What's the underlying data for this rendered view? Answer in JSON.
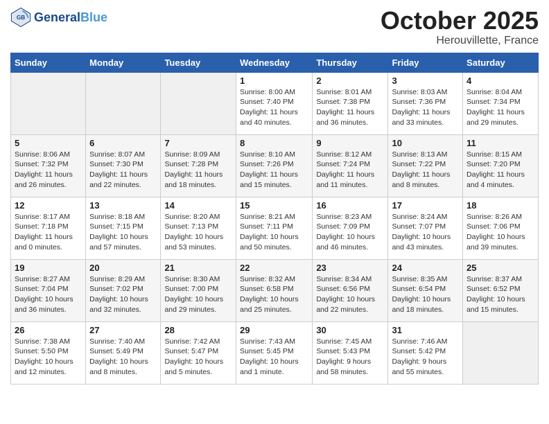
{
  "header": {
    "logo_line1": "General",
    "logo_line2": "Blue",
    "month": "October 2025",
    "location": "Herouvillette, France"
  },
  "weekdays": [
    "Sunday",
    "Monday",
    "Tuesday",
    "Wednesday",
    "Thursday",
    "Friday",
    "Saturday"
  ],
  "weeks": [
    [
      {
        "day": "",
        "info": ""
      },
      {
        "day": "",
        "info": ""
      },
      {
        "day": "",
        "info": ""
      },
      {
        "day": "1",
        "info": "Sunrise: 8:00 AM\nSunset: 7:40 PM\nDaylight: 11 hours\nand 40 minutes."
      },
      {
        "day": "2",
        "info": "Sunrise: 8:01 AM\nSunset: 7:38 PM\nDaylight: 11 hours\nand 36 minutes."
      },
      {
        "day": "3",
        "info": "Sunrise: 8:03 AM\nSunset: 7:36 PM\nDaylight: 11 hours\nand 33 minutes."
      },
      {
        "day": "4",
        "info": "Sunrise: 8:04 AM\nSunset: 7:34 PM\nDaylight: 11 hours\nand 29 minutes."
      }
    ],
    [
      {
        "day": "5",
        "info": "Sunrise: 8:06 AM\nSunset: 7:32 PM\nDaylight: 11 hours\nand 26 minutes."
      },
      {
        "day": "6",
        "info": "Sunrise: 8:07 AM\nSunset: 7:30 PM\nDaylight: 11 hours\nand 22 minutes."
      },
      {
        "day": "7",
        "info": "Sunrise: 8:09 AM\nSunset: 7:28 PM\nDaylight: 11 hours\nand 18 minutes."
      },
      {
        "day": "8",
        "info": "Sunrise: 8:10 AM\nSunset: 7:26 PM\nDaylight: 11 hours\nand 15 minutes."
      },
      {
        "day": "9",
        "info": "Sunrise: 8:12 AM\nSunset: 7:24 PM\nDaylight: 11 hours\nand 11 minutes."
      },
      {
        "day": "10",
        "info": "Sunrise: 8:13 AM\nSunset: 7:22 PM\nDaylight: 11 hours\nand 8 minutes."
      },
      {
        "day": "11",
        "info": "Sunrise: 8:15 AM\nSunset: 7:20 PM\nDaylight: 11 hours\nand 4 minutes."
      }
    ],
    [
      {
        "day": "12",
        "info": "Sunrise: 8:17 AM\nSunset: 7:18 PM\nDaylight: 11 hours\nand 0 minutes."
      },
      {
        "day": "13",
        "info": "Sunrise: 8:18 AM\nSunset: 7:15 PM\nDaylight: 10 hours\nand 57 minutes."
      },
      {
        "day": "14",
        "info": "Sunrise: 8:20 AM\nSunset: 7:13 PM\nDaylight: 10 hours\nand 53 minutes."
      },
      {
        "day": "15",
        "info": "Sunrise: 8:21 AM\nSunset: 7:11 PM\nDaylight: 10 hours\nand 50 minutes."
      },
      {
        "day": "16",
        "info": "Sunrise: 8:23 AM\nSunset: 7:09 PM\nDaylight: 10 hours\nand 46 minutes."
      },
      {
        "day": "17",
        "info": "Sunrise: 8:24 AM\nSunset: 7:07 PM\nDaylight: 10 hours\nand 43 minutes."
      },
      {
        "day": "18",
        "info": "Sunrise: 8:26 AM\nSunset: 7:06 PM\nDaylight: 10 hours\nand 39 minutes."
      }
    ],
    [
      {
        "day": "19",
        "info": "Sunrise: 8:27 AM\nSunset: 7:04 PM\nDaylight: 10 hours\nand 36 minutes."
      },
      {
        "day": "20",
        "info": "Sunrise: 8:29 AM\nSunset: 7:02 PM\nDaylight: 10 hours\nand 32 minutes."
      },
      {
        "day": "21",
        "info": "Sunrise: 8:30 AM\nSunset: 7:00 PM\nDaylight: 10 hours\nand 29 minutes."
      },
      {
        "day": "22",
        "info": "Sunrise: 8:32 AM\nSunset: 6:58 PM\nDaylight: 10 hours\nand 25 minutes."
      },
      {
        "day": "23",
        "info": "Sunrise: 8:34 AM\nSunset: 6:56 PM\nDaylight: 10 hours\nand 22 minutes."
      },
      {
        "day": "24",
        "info": "Sunrise: 8:35 AM\nSunset: 6:54 PM\nDaylight: 10 hours\nand 18 minutes."
      },
      {
        "day": "25",
        "info": "Sunrise: 8:37 AM\nSunset: 6:52 PM\nDaylight: 10 hours\nand 15 minutes."
      }
    ],
    [
      {
        "day": "26",
        "info": "Sunrise: 7:38 AM\nSunset: 5:50 PM\nDaylight: 10 hours\nand 12 minutes."
      },
      {
        "day": "27",
        "info": "Sunrise: 7:40 AM\nSunset: 5:49 PM\nDaylight: 10 hours\nand 8 minutes."
      },
      {
        "day": "28",
        "info": "Sunrise: 7:42 AM\nSunset: 5:47 PM\nDaylight: 10 hours\nand 5 minutes."
      },
      {
        "day": "29",
        "info": "Sunrise: 7:43 AM\nSunset: 5:45 PM\nDaylight: 10 hours\nand 1 minute."
      },
      {
        "day": "30",
        "info": "Sunrise: 7:45 AM\nSunset: 5:43 PM\nDaylight: 9 hours\nand 58 minutes."
      },
      {
        "day": "31",
        "info": "Sunrise: 7:46 AM\nSunset: 5:42 PM\nDaylight: 9 hours\nand 55 minutes."
      },
      {
        "day": "",
        "info": ""
      }
    ]
  ]
}
